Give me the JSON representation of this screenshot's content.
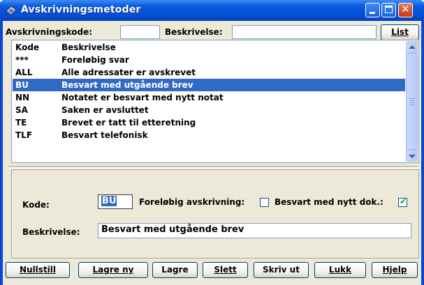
{
  "window": {
    "title": "Avskrivningsmetoder"
  },
  "filter": {
    "code_label": "Avskrivningskode:",
    "code_value": "",
    "desc_label": "Beskrivelse:",
    "desc_value": "",
    "list_button": "List"
  },
  "list": {
    "columns": [
      "Kode",
      "Beskrivelse"
    ],
    "rows": [
      {
        "code": "***",
        "desc": "Foreløbig svar"
      },
      {
        "code": "ALL",
        "desc": "Alle adressater er avskrevet"
      },
      {
        "code": "BU",
        "desc": "Besvart med utgående brev"
      },
      {
        "code": "NN",
        "desc": "Notatet er besvart med nytt notat"
      },
      {
        "code": "SA",
        "desc": "Saken er avsluttet"
      },
      {
        "code": "TE",
        "desc": "Brevet er tatt til etteretning"
      },
      {
        "code": "TLF",
        "desc": "Besvart telefonisk"
      }
    ],
    "selected_index": 2
  },
  "detail": {
    "code_label": "Kode:",
    "code_value": "BU",
    "prelim_label": "Foreløbig avskrivning:",
    "prelim_checked": false,
    "newdoc_label": "Besvart med nytt dok.:",
    "newdoc_checked": true,
    "desc_label": "Beskrivelse:",
    "desc_value": "Besvart med utgående brev"
  },
  "buttons": {
    "reset": "Nullstill",
    "save_new": "Lagre ny",
    "save": "Lagre",
    "delete": "Slett",
    "print": "Skriv ut",
    "close": "Lukk",
    "help": "Hjelp"
  }
}
